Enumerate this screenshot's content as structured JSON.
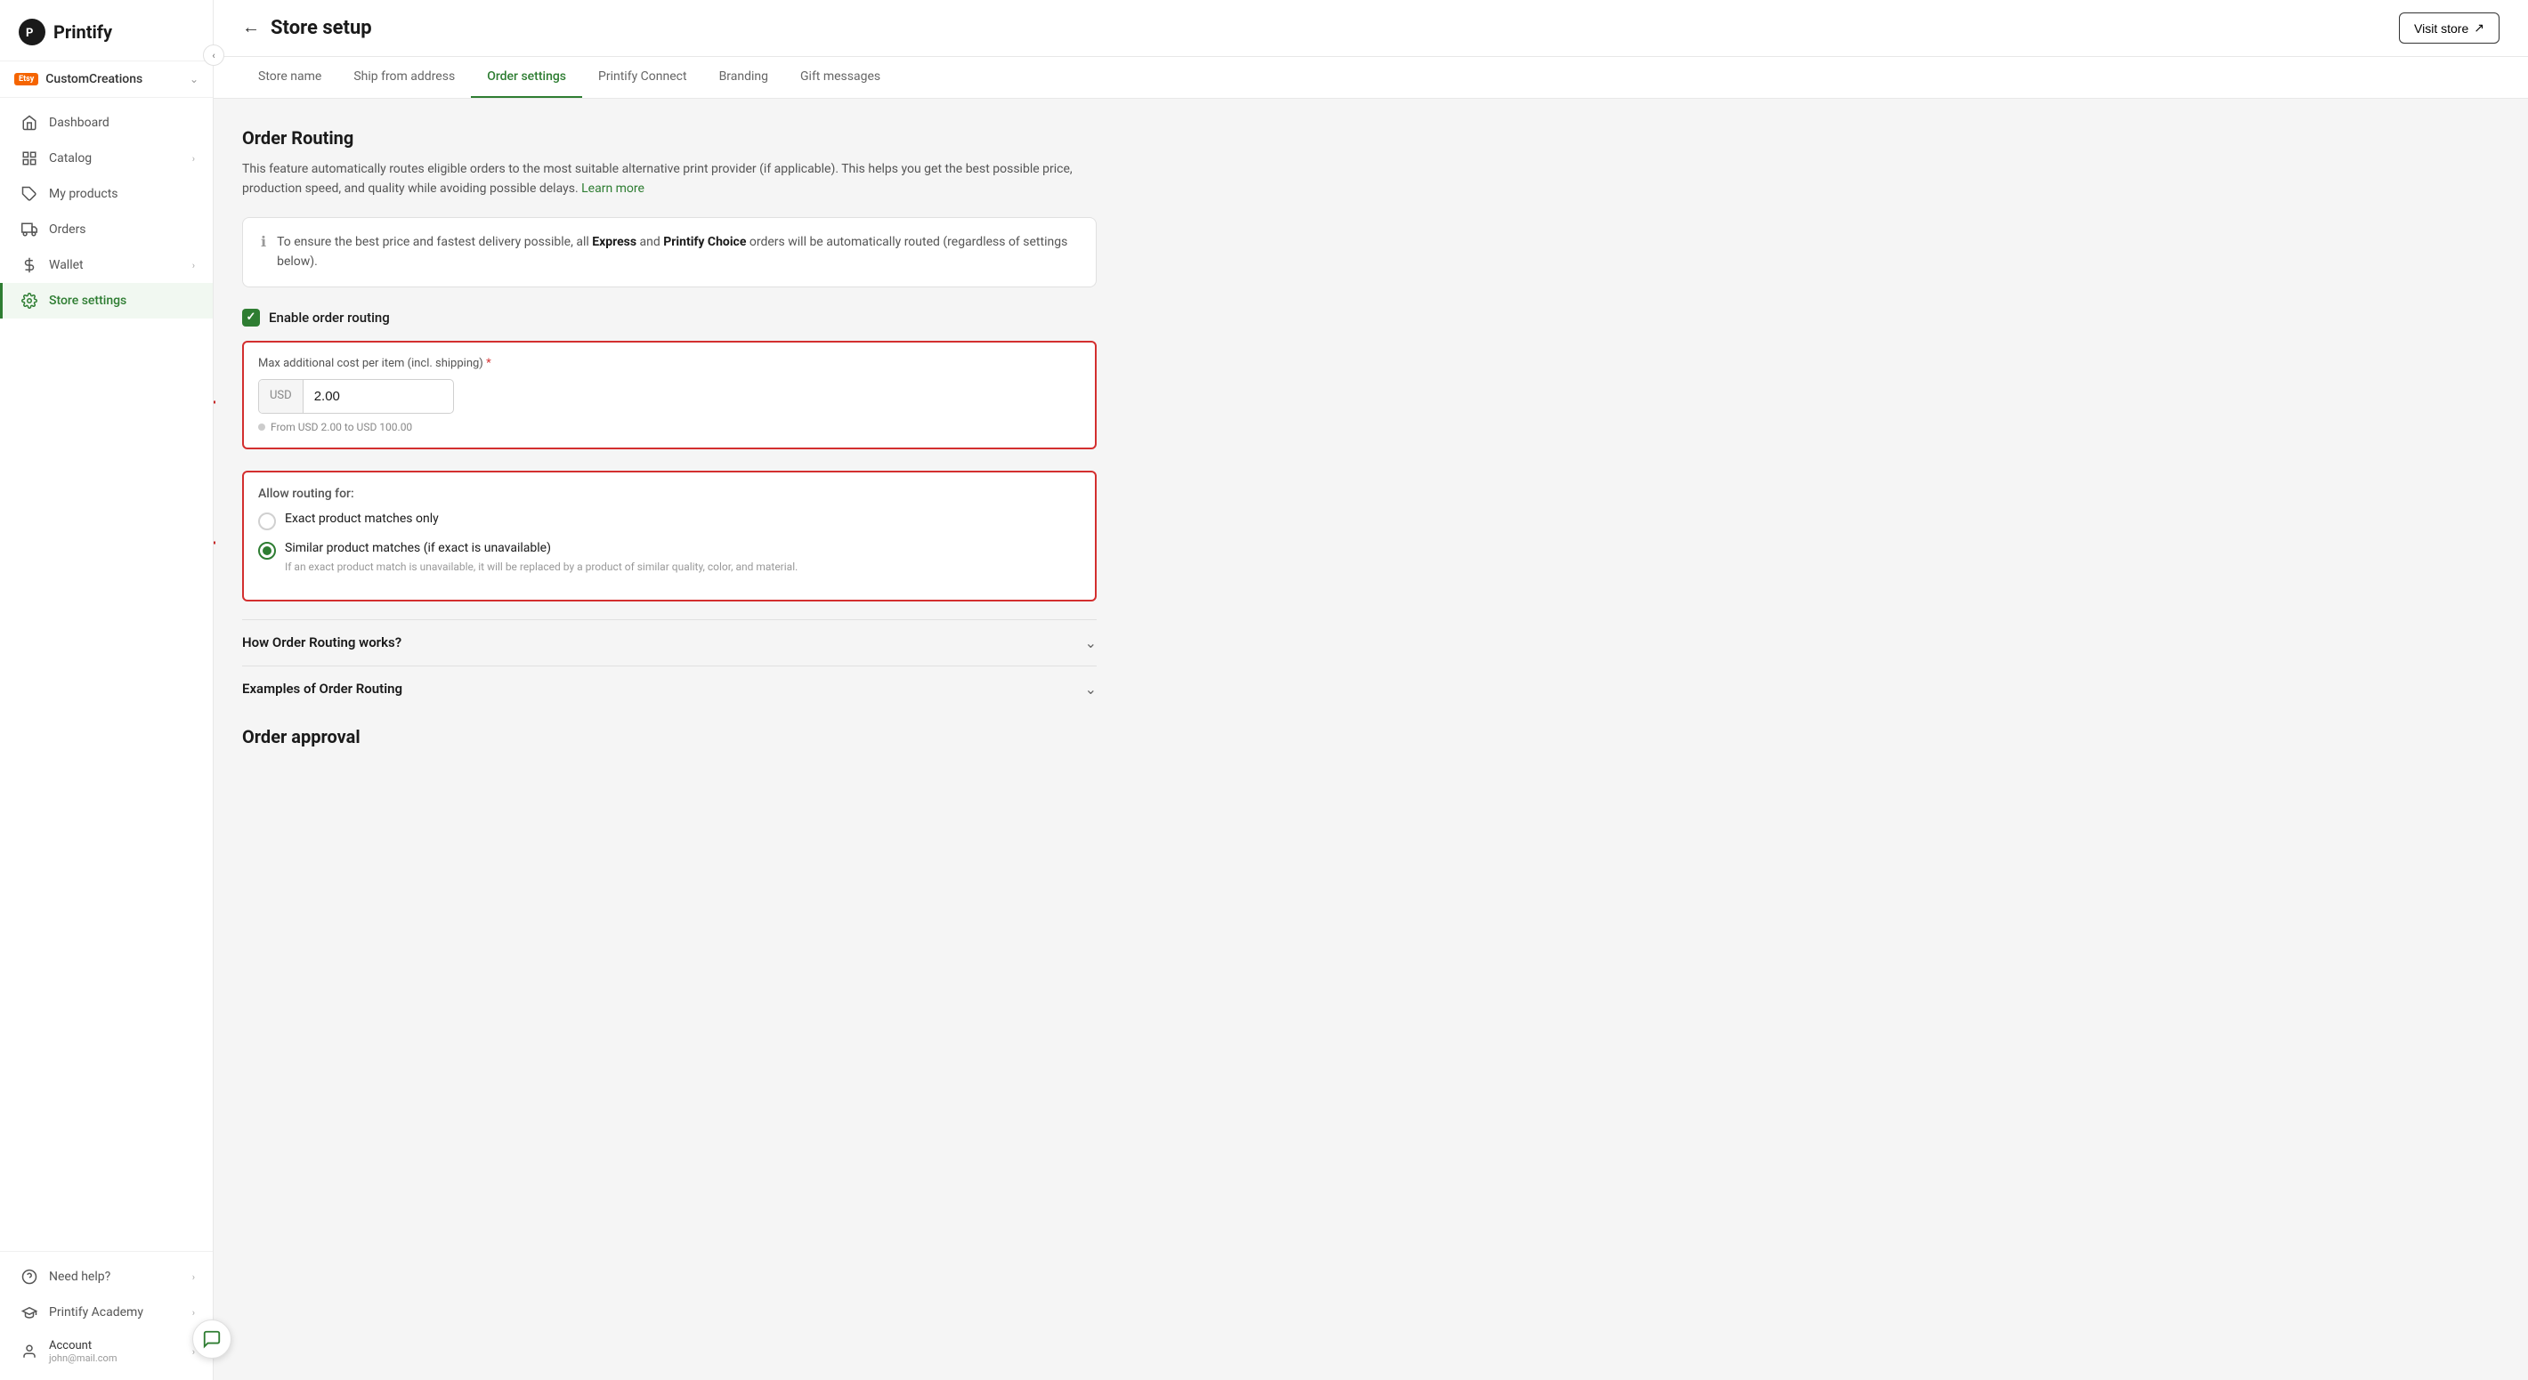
{
  "brand": {
    "name": "Printify",
    "logo_alt": "Printify logo"
  },
  "store": {
    "badge": "Etsy",
    "name": "CustomCreations",
    "chevron": "⌃"
  },
  "nav": {
    "items": [
      {
        "id": "dashboard",
        "label": "Dashboard",
        "icon": "house",
        "active": false,
        "has_chevron": false
      },
      {
        "id": "catalog",
        "label": "Catalog",
        "icon": "grid",
        "active": false,
        "has_chevron": true
      },
      {
        "id": "my-products",
        "label": "My products",
        "icon": "tag",
        "active": false,
        "has_chevron": false
      },
      {
        "id": "orders",
        "label": "Orders",
        "icon": "truck",
        "active": false,
        "has_chevron": false
      },
      {
        "id": "wallet",
        "label": "Wallet",
        "icon": "dollar",
        "active": false,
        "has_chevron": true
      },
      {
        "id": "store-settings",
        "label": "Store settings",
        "icon": "gear",
        "active": true,
        "has_chevron": false
      }
    ],
    "bottom_items": [
      {
        "id": "need-help",
        "label": "Need help?",
        "icon": "circle-question",
        "has_chevron": true
      },
      {
        "id": "printify-academy",
        "label": "Printify Academy",
        "icon": "graduation",
        "has_chevron": true
      },
      {
        "id": "account",
        "label": "Account",
        "sub": "john@mail.com",
        "icon": "person-circle",
        "has_chevron": true
      }
    ]
  },
  "topbar": {
    "back_label": "←",
    "title": "Store setup",
    "visit_store_label": "Visit store",
    "visit_store_icon": "↗"
  },
  "tabs": [
    {
      "id": "store-name",
      "label": "Store name",
      "active": false
    },
    {
      "id": "ship-from",
      "label": "Ship from address",
      "active": false
    },
    {
      "id": "order-settings",
      "label": "Order settings",
      "active": true
    },
    {
      "id": "printify-connect",
      "label": "Printify Connect",
      "active": false
    },
    {
      "id": "branding",
      "label": "Branding",
      "active": false
    },
    {
      "id": "gift-messages",
      "label": "Gift messages",
      "active": false
    }
  ],
  "order_routing": {
    "title": "Order Routing",
    "description": "This feature automatically routes eligible orders to the most suitable alternative print provider (if applicable). This helps you get the best possible price, production speed, and quality while avoiding possible delays.",
    "learn_more_label": "Learn more",
    "info_box_text": "To ensure the best price and fastest delivery possible, all ",
    "info_box_express": "Express",
    "info_box_middle": " and ",
    "info_box_choice": "Printify Choice",
    "info_box_end": " orders will be automatically routed (regardless of settings below).",
    "enable_label": "Enable order routing",
    "max_cost_label": "Max additional cost per item (incl. shipping)",
    "required_marker": "*",
    "currency": "USD",
    "cost_value": "2.00",
    "hint_text": "From USD 2.00 to USD 100.00",
    "allow_routing_label": "Allow routing for:",
    "radio_exact_label": "Exact product matches only",
    "radio_similar_label": "Similar product matches (if exact is unavailable)",
    "radio_similar_sub": "If an exact product match is unavailable, it will be replaced by a product of similar quality, color, and material.",
    "accordion_1": "How Order Routing works?",
    "accordion_2": "Examples of Order Routing"
  },
  "order_approval": {
    "title": "Order approval"
  },
  "colors": {
    "green": "#2e7d32",
    "red": "#d32f2f",
    "accent_green": "#1b5e20"
  }
}
